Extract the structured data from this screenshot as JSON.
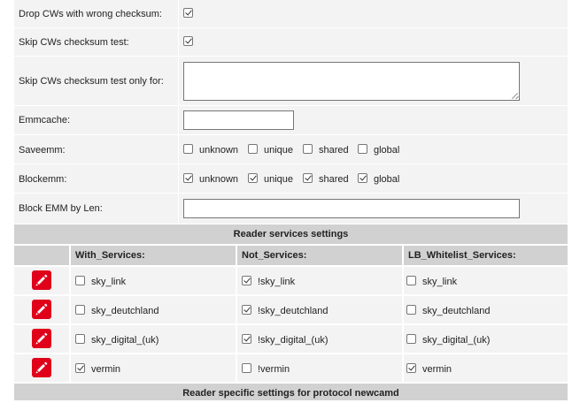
{
  "settings": {
    "drop_cws_label": "Drop CWs with wrong checksum:",
    "drop_cws_checked": true,
    "skip_cws_label": "Skip CWs checksum test:",
    "skip_cws_checked": true,
    "skip_cws_only_label": "Skip CWs checksum test only for:",
    "skip_cws_only_value": "",
    "emmcache_label": "Emmcache:",
    "emmcache_value": "",
    "saveemm_label": "Saveemm:",
    "saveemm_options": [
      {
        "label": "unknown",
        "checked": false
      },
      {
        "label": "unique",
        "checked": false
      },
      {
        "label": "shared",
        "checked": false
      },
      {
        "label": "global",
        "checked": false
      }
    ],
    "blockemm_label": "Blockemm:",
    "blockemm_options": [
      {
        "label": "unknown",
        "checked": true
      },
      {
        "label": "unique",
        "checked": true
      },
      {
        "label": "shared",
        "checked": true
      },
      {
        "label": "global",
        "checked": true
      }
    ],
    "block_emm_len_label": "Block EMM by Len:",
    "block_emm_len_value": ""
  },
  "services": {
    "title": "Reader services settings",
    "headers": [
      "With_Services:",
      "Not_Services:",
      "LB_Whitelist_Services:"
    ],
    "rows": [
      {
        "with": {
          "label": "sky_link",
          "checked": false
        },
        "not": {
          "label": "!sky_link",
          "checked": true
        },
        "lb": {
          "label": "sky_link",
          "checked": false
        }
      },
      {
        "with": {
          "label": "sky_deutchland",
          "checked": false
        },
        "not": {
          "label": "!sky_deutchland",
          "checked": true
        },
        "lb": {
          "label": "sky_deutchland",
          "checked": false
        }
      },
      {
        "with": {
          "label": "sky_digital_(uk)",
          "checked": false
        },
        "not": {
          "label": "!sky_digital_(uk)",
          "checked": true
        },
        "lb": {
          "label": "sky_digital_(uk)",
          "checked": false
        }
      },
      {
        "with": {
          "label": "vermin",
          "checked": true
        },
        "not": {
          "label": "!vermin",
          "checked": false
        },
        "lb": {
          "label": "vermin",
          "checked": true
        }
      }
    ]
  },
  "protocol_section": {
    "title": "Reader specific settings for protocol newcamd"
  },
  "colors": {
    "row_bg": "#f3f3f3",
    "header_bg": "#d1d1d1",
    "edit_icon_bg": "#e0001a"
  },
  "icons": {
    "edit": "pencil-icon"
  }
}
